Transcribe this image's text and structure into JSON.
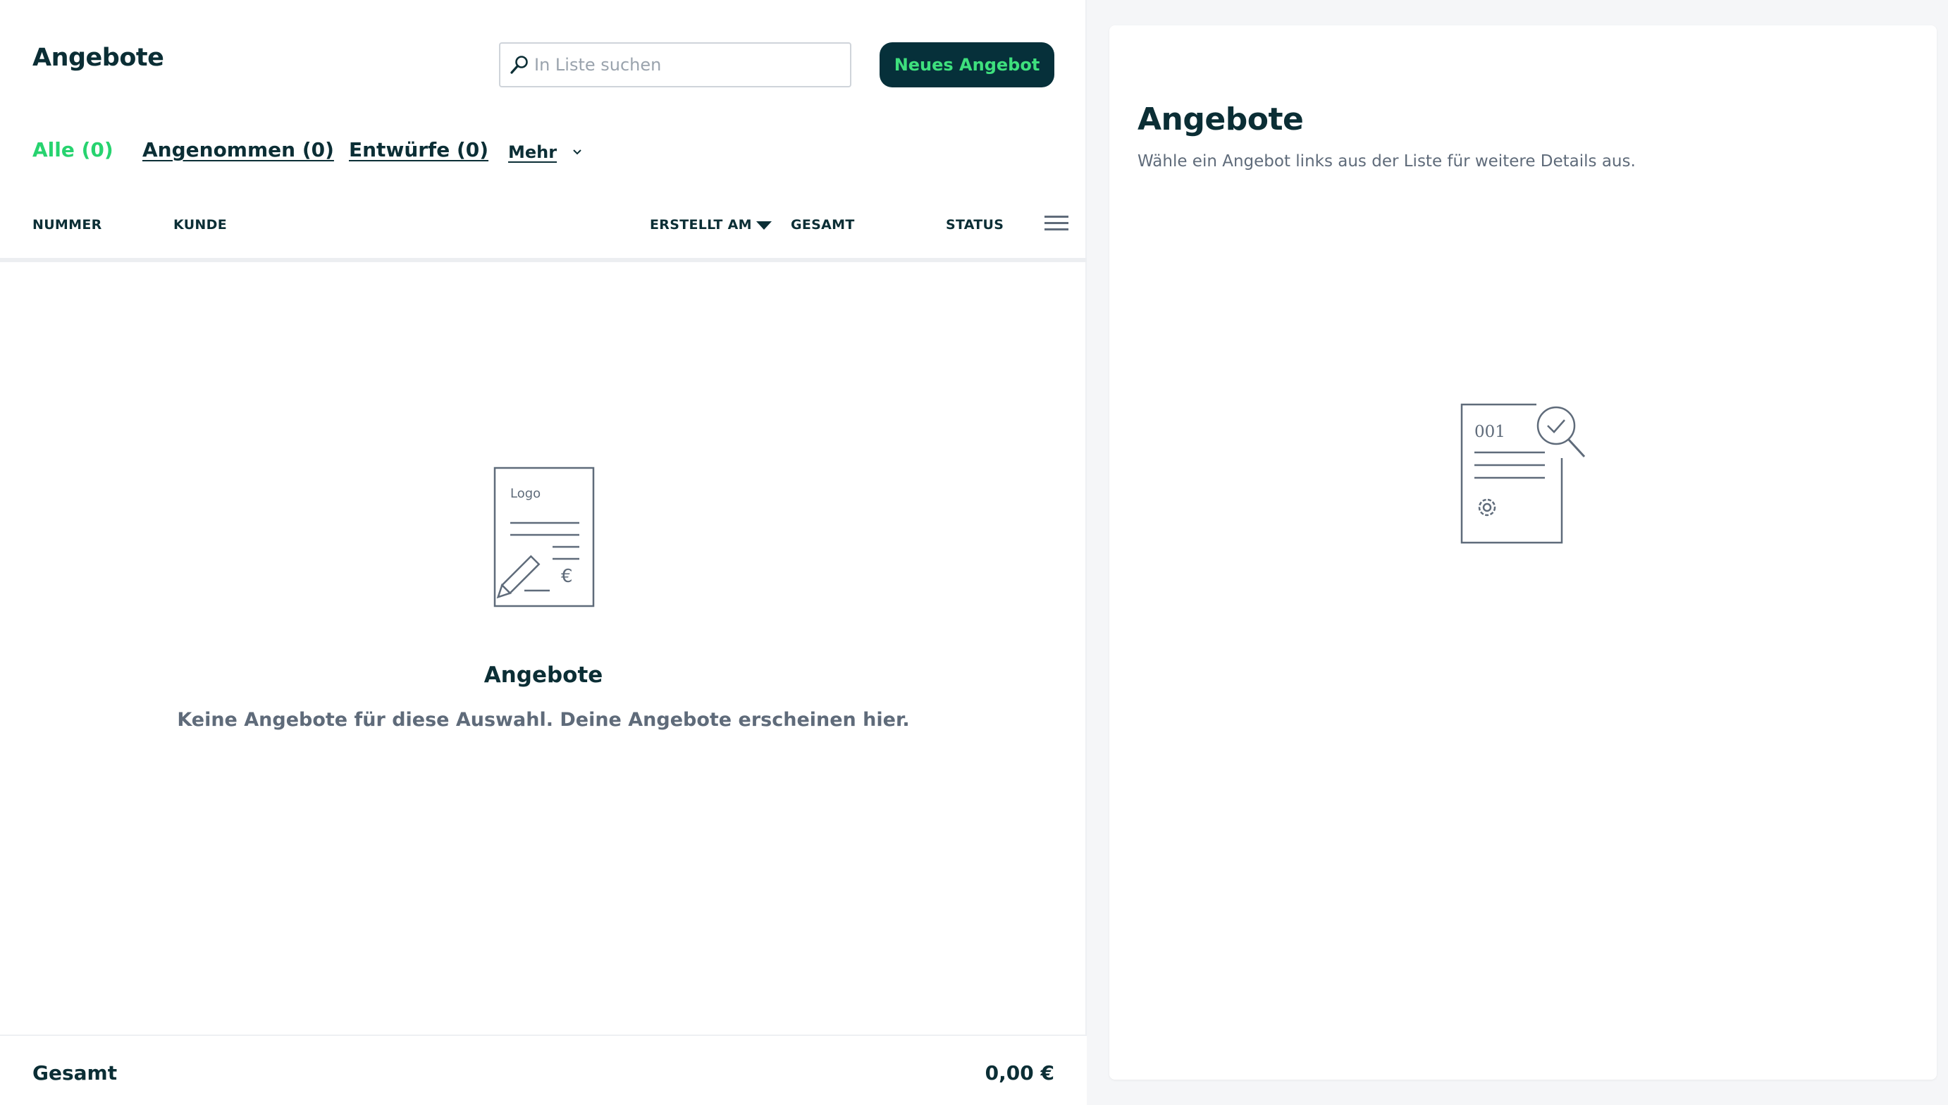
{
  "header": {
    "title": "Angebote",
    "search_placeholder": "In Liste suchen",
    "new_button_label": "Neues Angebot"
  },
  "tabs": [
    {
      "label": "Alle (0)",
      "active": true
    },
    {
      "label": "Angenommen (0)",
      "active": false
    },
    {
      "label": "Entwürfe (0)",
      "active": false
    },
    {
      "label": "Mehr",
      "active": false
    }
  ],
  "table": {
    "columns": [
      "NUMMER",
      "KUNDE",
      "ERSTELLT AM",
      "GESAMT",
      "STATUS"
    ],
    "sort_column": "ERSTELLT AM",
    "sort_direction": "desc",
    "rows": []
  },
  "empty_state": {
    "illustration_text": "Logo",
    "illustration_currency": "€",
    "title": "Angebote",
    "text": "Keine Angebote für diese Auswahl. Deine Angebote erscheinen hier."
  },
  "footer": {
    "total_label": "Gesamt",
    "total_value": "0,00 €"
  },
  "detail": {
    "title": "Angebote",
    "text": "Wähle ein Angebot links aus der Liste für weitere Details aus.",
    "illustration_number": "001"
  },
  "colors": {
    "accent_green": "#27d36f",
    "button_bg": "#06303a",
    "button_text": "#3ee07d",
    "text_primary": "#0b2e35",
    "text_muted": "#5f6b7a",
    "page_bg": "#f5f6f8"
  },
  "icons": {
    "search": "search-icon",
    "sort": "sort-desc-icon",
    "menu": "hamburger-menu-icon",
    "chevron": "chevron-down-icon"
  }
}
